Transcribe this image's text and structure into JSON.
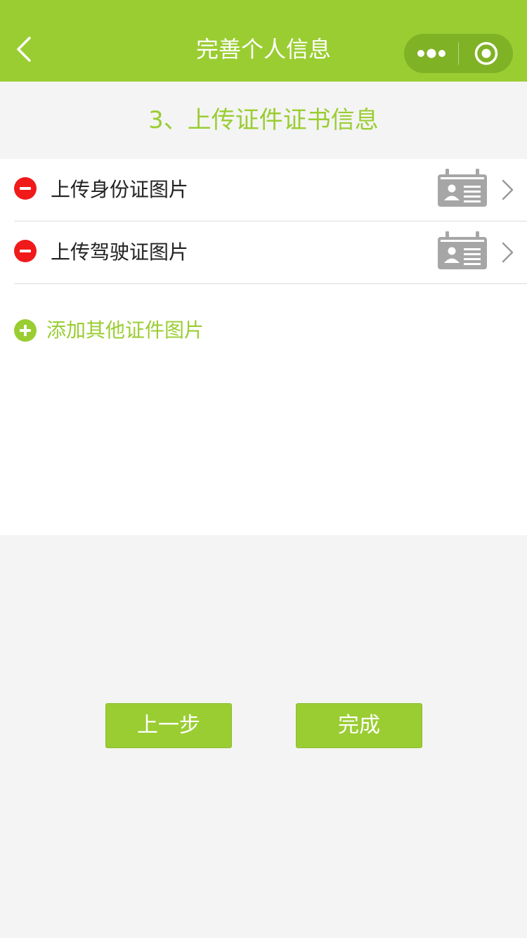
{
  "header": {
    "title": "完善个人信息",
    "back_icon": "chevron-left-icon",
    "more_icon": "more-dots-icon",
    "close_icon": "target-circle-icon"
  },
  "step": {
    "title": "3、上传证件证书信息"
  },
  "documents": [
    {
      "label": "上传身份证图片",
      "remove_icon": "minus-circle-icon",
      "thumb_icon": "id-card-icon",
      "chevron_icon": "chevron-right-icon"
    },
    {
      "label": "上传驾驶证图片",
      "remove_icon": "minus-circle-icon",
      "thumb_icon": "id-card-icon",
      "chevron_icon": "chevron-right-icon"
    }
  ],
  "add_other": {
    "label": "添加其他证件图片",
    "icon": "plus-circle-icon"
  },
  "buttons": {
    "prev_label": "上一步",
    "done_label": "完成"
  },
  "colors": {
    "brand": "#9acd32",
    "capsule": "#80b226",
    "danger": "#f01a1a",
    "page_bg": "#f4f4f4",
    "icon_gray": "#a6a6a6"
  }
}
